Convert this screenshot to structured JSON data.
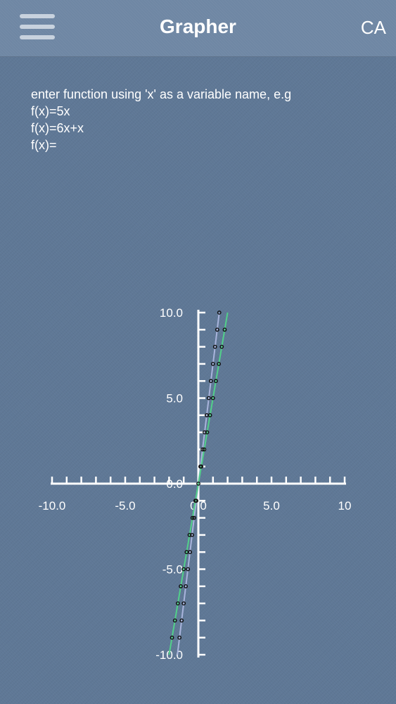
{
  "header": {
    "title": "Grapher",
    "right_label": "CA",
    "menu_icon": "hamburger-menu-icon"
  },
  "prompt": {
    "instruction": "enter function using 'x' as a variable name, e.g",
    "example_1": "f(x)=5x",
    "example_2": "f(x)=6x+x",
    "input_prefix": "f(x)=",
    "input_value": ""
  },
  "colors": {
    "background": "#5f7896",
    "axis": "#ffffff",
    "series_1": "#a9b4dc",
    "series_2": "#52d08a",
    "marker": "#111111"
  },
  "chart_data": {
    "type": "line",
    "xlim": [
      -10,
      10
    ],
    "ylim": [
      -10,
      10
    ],
    "x_tick_labels": [
      "-10.0",
      "-5.0",
      "0.0",
      "5.0",
      "10"
    ],
    "y_tick_labels": [
      "-10.0",
      "-5.0",
      "0.0",
      "5.0",
      "10.0"
    ],
    "grid": false,
    "series": [
      {
        "color": "#a9b4dc",
        "slope": 7,
        "x": [
          -1.43,
          1.43
        ],
        "y": [
          -10,
          10
        ]
      },
      {
        "color": "#52d08a",
        "slope": 5,
        "x": [
          -2,
          2
        ],
        "y": [
          -10,
          10
        ]
      }
    ],
    "markers": [
      {
        "x": 0,
        "y": 0
      },
      {
        "x": 0.14,
        "y": 1
      },
      {
        "x": 0.29,
        "y": 2
      },
      {
        "x": 0.43,
        "y": 3
      },
      {
        "x": 0.57,
        "y": 4
      },
      {
        "x": 0.71,
        "y": 5
      },
      {
        "x": 0.86,
        "y": 6
      },
      {
        "x": 1.0,
        "y": 7
      },
      {
        "x": 1.14,
        "y": 8
      },
      {
        "x": 1.29,
        "y": 9
      },
      {
        "x": 1.43,
        "y": 10
      },
      {
        "x": -0.14,
        "y": -1
      },
      {
        "x": -0.29,
        "y": -2
      },
      {
        "x": -0.43,
        "y": -3
      },
      {
        "x": -0.57,
        "y": -4
      },
      {
        "x": -0.71,
        "y": -5
      },
      {
        "x": -0.86,
        "y": -6
      },
      {
        "x": -1.0,
        "y": -7
      },
      {
        "x": -1.14,
        "y": -8
      },
      {
        "x": -1.29,
        "y": -9
      },
      {
        "x": 0.2,
        "y": 1
      },
      {
        "x": 0.4,
        "y": 2
      },
      {
        "x": 0.6,
        "y": 3
      },
      {
        "x": 0.8,
        "y": 4
      },
      {
        "x": 1.0,
        "y": 5
      },
      {
        "x": 1.2,
        "y": 6
      },
      {
        "x": 1.4,
        "y": 7
      },
      {
        "x": 1.6,
        "y": 8
      },
      {
        "x": 1.8,
        "y": 9
      },
      {
        "x": -0.2,
        "y": -1
      },
      {
        "x": -0.4,
        "y": -2
      },
      {
        "x": -0.6,
        "y": -3
      },
      {
        "x": -0.8,
        "y": -4
      },
      {
        "x": -1.0,
        "y": -5
      },
      {
        "x": -1.2,
        "y": -6
      },
      {
        "x": -1.4,
        "y": -7
      },
      {
        "x": -1.6,
        "y": -8
      },
      {
        "x": -1.8,
        "y": -9
      }
    ]
  }
}
